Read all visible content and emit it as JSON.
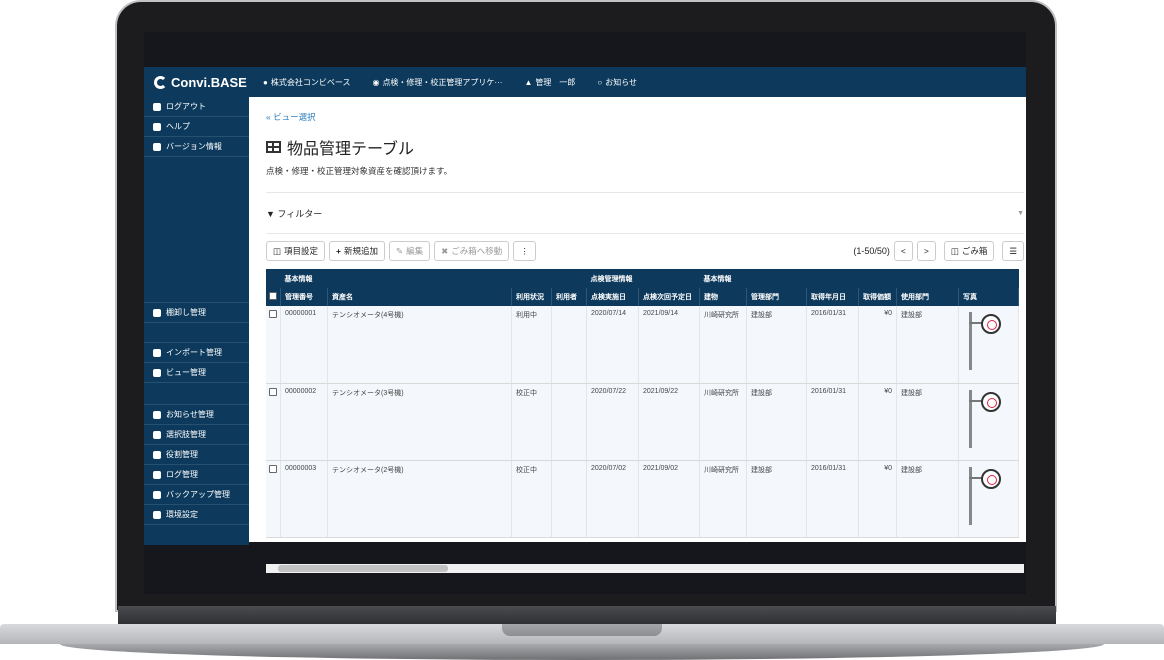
{
  "app": {
    "brand": "Convi.BASE",
    "topnav": {
      "company": "株式会社コンビベース",
      "app": "点検・修理・校正管理アプリケ···",
      "user": "管理　一郎",
      "notice": "お知らせ"
    }
  },
  "sidebar": {
    "top": [
      {
        "label": "ログアウト",
        "icon": "power-icon"
      },
      {
        "label": "ヘルプ",
        "icon": "help-icon"
      },
      {
        "label": "バージョン情報",
        "icon": "info-icon"
      }
    ],
    "group1": [
      {
        "label": "棚卸し管理",
        "icon": "monitor-icon"
      }
    ],
    "group2": [
      {
        "label": "インポート管理",
        "icon": "upload-icon"
      },
      {
        "label": "ビュー管理",
        "icon": "table-icon"
      }
    ],
    "group3": [
      {
        "label": "お知らせ管理",
        "icon": "chat-icon"
      },
      {
        "label": "選択肢管理",
        "icon": "list-icon"
      },
      {
        "label": "役割管理",
        "icon": "lock-icon"
      },
      {
        "label": "ログ管理",
        "icon": "edit-icon"
      },
      {
        "label": "バックアップ管理",
        "icon": "database-icon"
      },
      {
        "label": "環境設定",
        "icon": "gears-icon"
      }
    ]
  },
  "main": {
    "back_link": "« ビュー選択",
    "title": "物品管理テーブル",
    "subtitle": "点検・修理・校正管理対象資産を確認頂けます。",
    "filter": "フィルター",
    "toolbar": {
      "columns": "項目設定",
      "add": "新規追加",
      "edit": "編集",
      "trash_move": "ごみ箱へ移動",
      "pager": "(1-50/50)",
      "trash": "ごみ箱"
    },
    "table": {
      "groups": [
        {
          "label": "基本情報"
        },
        {
          "label": "点検管理情報"
        },
        {
          "label": "基本情報"
        }
      ],
      "headers": [
        "管理番号",
        "資産名",
        "利用状況",
        "利用者",
        "点検実施日",
        "点検次回予定日",
        "建物",
        "管理部門",
        "取得年月日",
        "取得価額",
        "使用部門",
        "写真"
      ],
      "rows": [
        {
          "id": "00000001",
          "name": "テンシオメータ(4号機)",
          "status": "利用中",
          "user": "",
          "inspected": "2020/07/14",
          "next": "2021/09/14",
          "building": "川崎研究所",
          "dept": "建設部",
          "acquired": "2016/01/31",
          "price": "¥0",
          "use_dept": "建設部"
        },
        {
          "id": "00000002",
          "name": "テンシオメータ(3号機)",
          "status": "校正中",
          "user": "",
          "inspected": "2020/07/22",
          "next": "2021/09/22",
          "building": "川崎研究所",
          "dept": "建設部",
          "acquired": "2016/01/31",
          "price": "¥0",
          "use_dept": "建設部"
        },
        {
          "id": "00000003",
          "name": "テンシオメータ(2号機)",
          "status": "校正中",
          "user": "",
          "inspected": "2020/07/02",
          "next": "2021/09/02",
          "building": "川崎研究所",
          "dept": "建設部",
          "acquired": "2016/01/31",
          "price": "¥0",
          "use_dept": "建設部"
        }
      ]
    }
  }
}
